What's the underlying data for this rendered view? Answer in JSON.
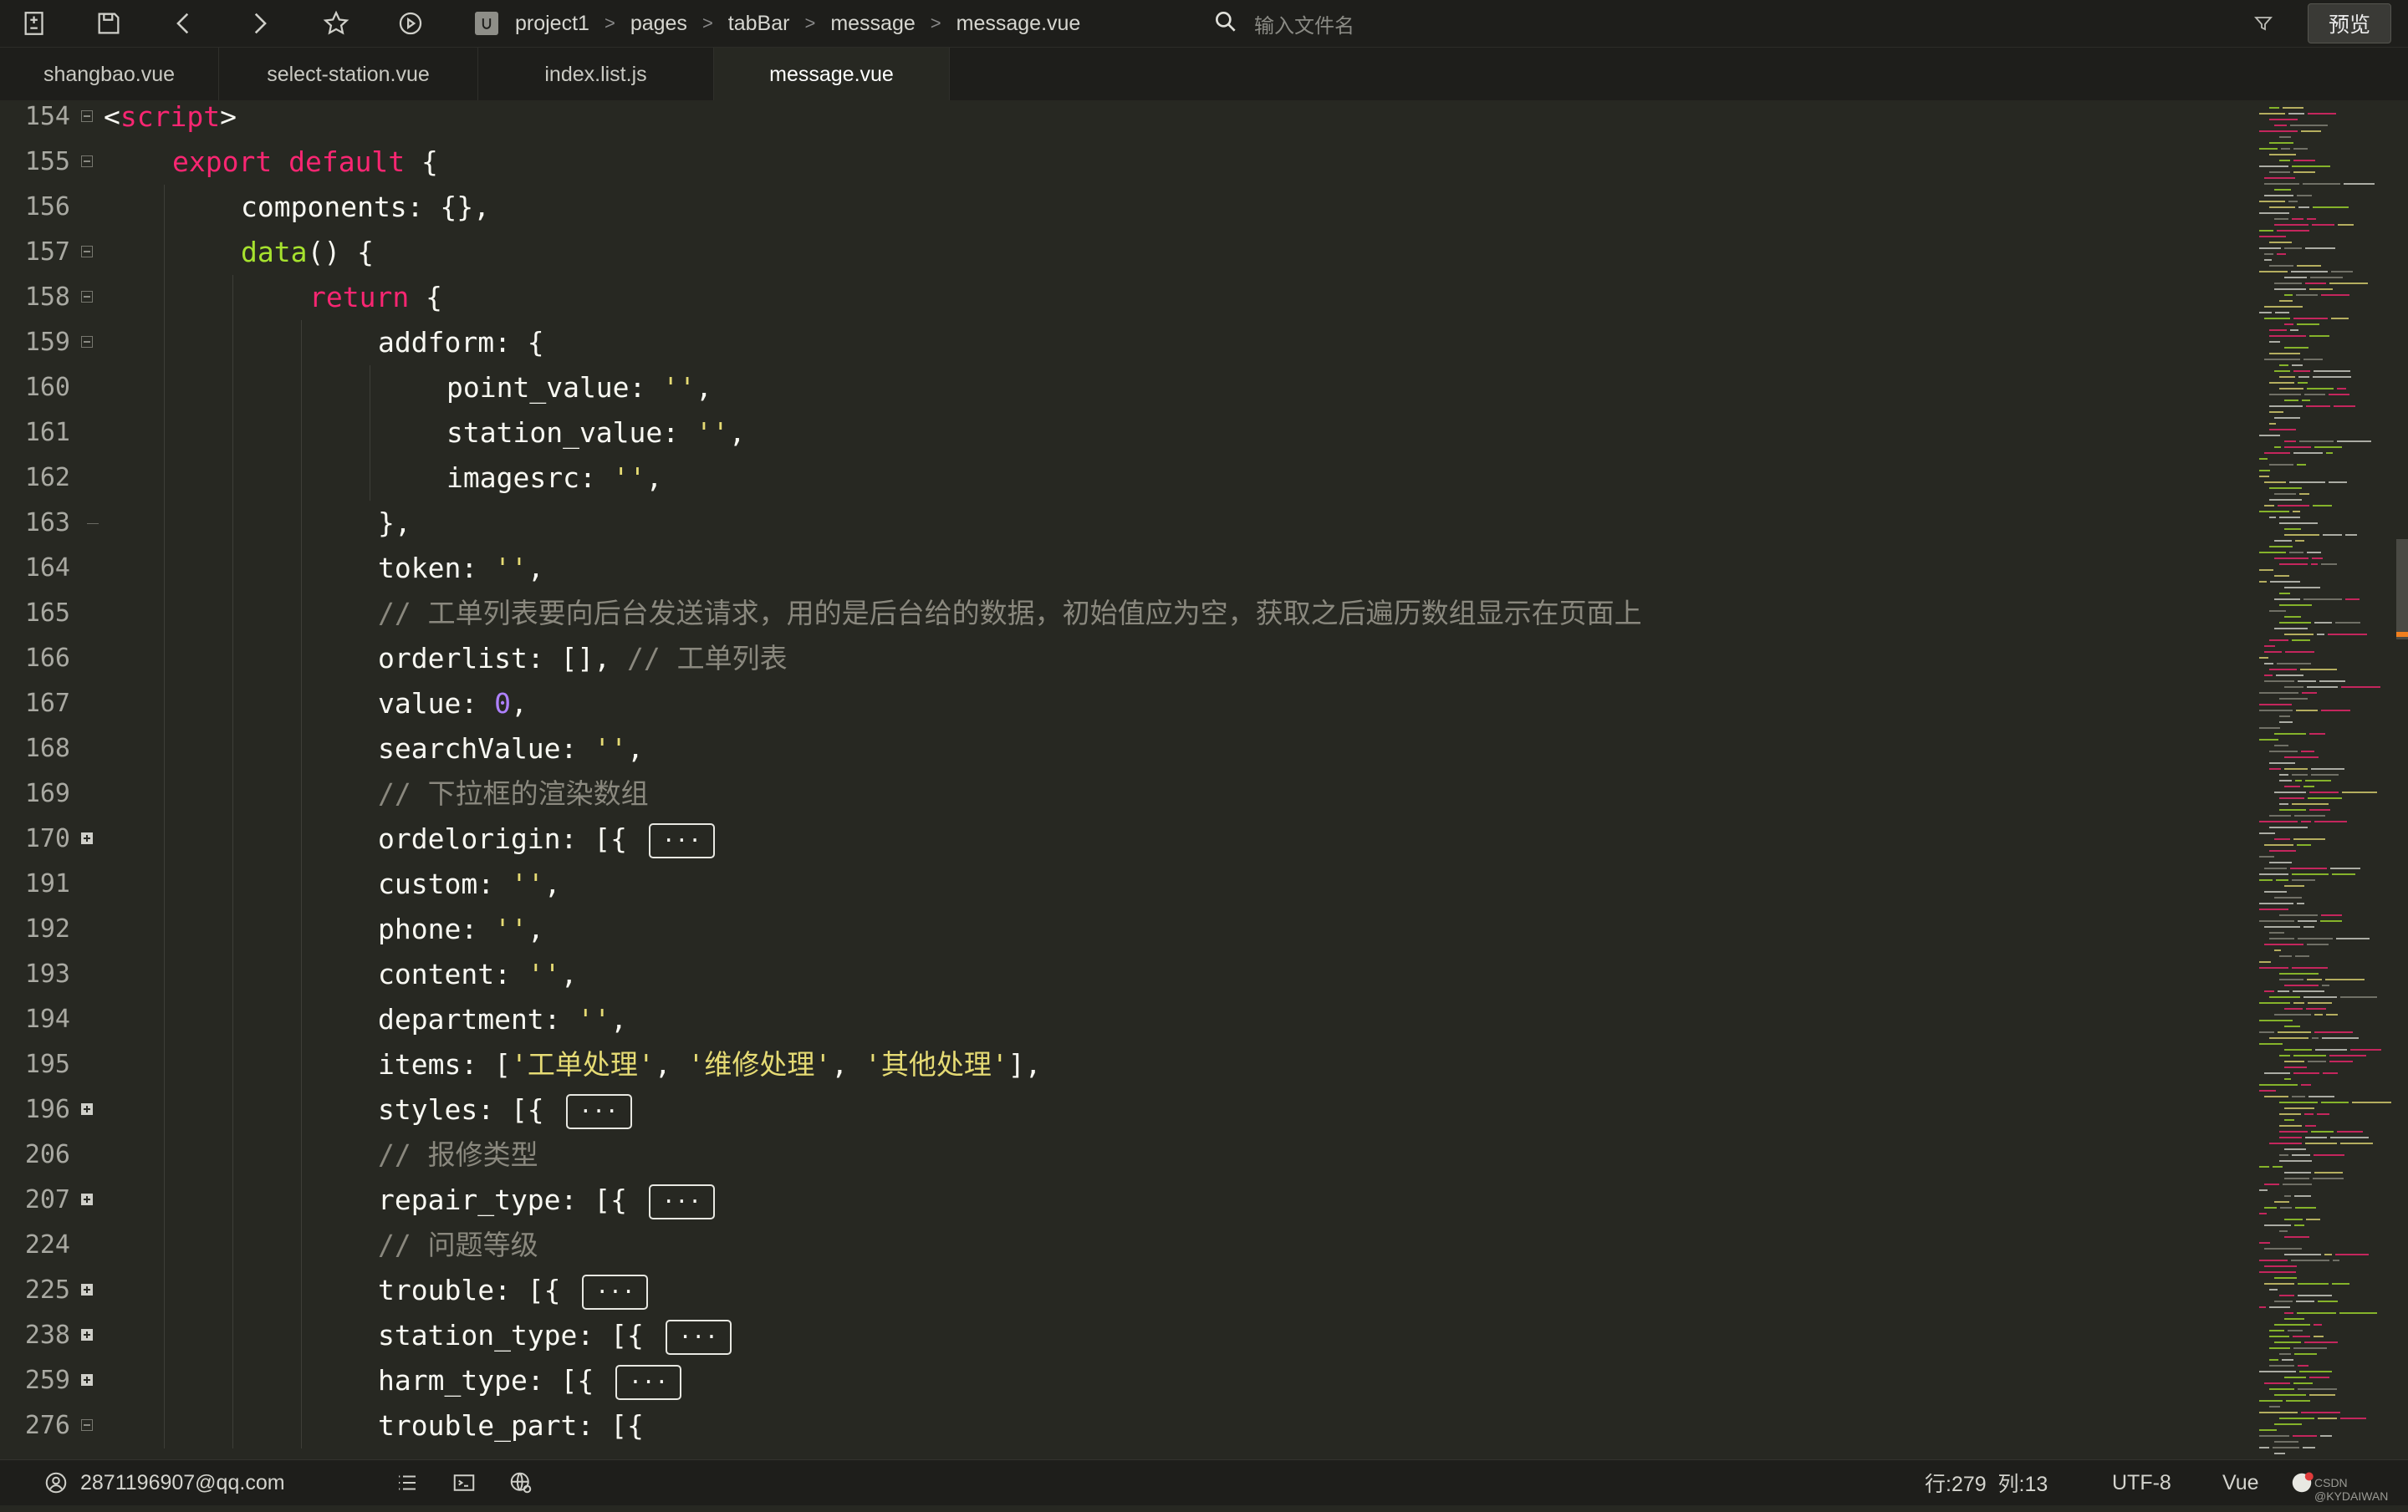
{
  "toolbar": {
    "breadcrumb": [
      "project1",
      "pages",
      "tabBar",
      "message",
      "message.vue"
    ],
    "search_placeholder": "输入文件名",
    "preview_label": "预览"
  },
  "tabs": [
    {
      "label": "shangbao.vue",
      "active": false
    },
    {
      "label": "select-station.vue",
      "active": false
    },
    {
      "label": "index.list.js",
      "active": false
    },
    {
      "label": "message.vue",
      "active": true
    }
  ],
  "code": {
    "lines": [
      {
        "n": "154",
        "fold": "minus",
        "indent": 0,
        "html": "&lt;<span class=\"kw\">script</span>&gt;"
      },
      {
        "n": "155",
        "fold": "minus",
        "indent": 1,
        "html": "<span class=\"kw\">export</span> <span class=\"kw\">default</span> {"
      },
      {
        "n": "156",
        "fold": "",
        "indent": 2,
        "html": "components: {},"
      },
      {
        "n": "157",
        "fold": "minus",
        "indent": 2,
        "html": "<span class=\"fn\">data</span>() {"
      },
      {
        "n": "158",
        "fold": "minus",
        "indent": 3,
        "html": "<span class=\"kw\">return</span> {"
      },
      {
        "n": "159",
        "fold": "minus",
        "indent": 4,
        "html": "addform: {"
      },
      {
        "n": "160",
        "fold": "",
        "indent": 5,
        "html": "point_value: <span class=\"str\">''</span>,"
      },
      {
        "n": "161",
        "fold": "",
        "indent": 5,
        "html": "station_value: <span class=\"str\">''</span>,"
      },
      {
        "n": "162",
        "fold": "",
        "indent": 5,
        "html": "imagesrc: <span class=\"str\">''</span>,"
      },
      {
        "n": "163",
        "fold": "end",
        "indent": 4,
        "html": "},"
      },
      {
        "n": "164",
        "fold": "",
        "indent": 4,
        "html": "token: <span class=\"str\">''</span>,"
      },
      {
        "n": "165",
        "fold": "",
        "indent": 4,
        "html": "<span class=\"cm\">// 工单列表要向后台发送请求，用的是后台给的数据，初始值应为空，获取之后遍历数组显示在页面上</span>"
      },
      {
        "n": "166",
        "fold": "",
        "indent": 4,
        "html": "orderlist: [], <span class=\"cm\">// 工单列表</span>"
      },
      {
        "n": "167",
        "fold": "",
        "indent": 4,
        "html": "value: <span class=\"num\">0</span>,"
      },
      {
        "n": "168",
        "fold": "",
        "indent": 4,
        "html": "searchValue: <span class=\"str\">''</span>,"
      },
      {
        "n": "169",
        "fold": "",
        "indent": 4,
        "html": "<span class=\"cm\">// 下拉框的渲染数组</span>"
      },
      {
        "n": "170",
        "fold": "plus",
        "indent": 4,
        "html": "ordelorigin: [{ <span class=\"collapsed\">···</span>"
      },
      {
        "n": "191",
        "fold": "",
        "indent": 4,
        "html": "custom: <span class=\"str\">''</span>,"
      },
      {
        "n": "192",
        "fold": "",
        "indent": 4,
        "html": "phone: <span class=\"str\">''</span>,"
      },
      {
        "n": "193",
        "fold": "",
        "indent": 4,
        "html": "content: <span class=\"str\">''</span>,"
      },
      {
        "n": "194",
        "fold": "",
        "indent": 4,
        "html": "department: <span class=\"str\">''</span>,"
      },
      {
        "n": "195",
        "fold": "",
        "indent": 4,
        "html": "items: [<span class=\"str\">'工单处理'</span>, <span class=\"str\">'维修处理'</span>, <span class=\"str\">'其他处理'</span>],"
      },
      {
        "n": "196",
        "fold": "plus",
        "indent": 4,
        "html": "styles: [{ <span class=\"collapsed\">···</span>"
      },
      {
        "n": "206",
        "fold": "",
        "indent": 4,
        "html": "<span class=\"cm\">// 报修类型</span>"
      },
      {
        "n": "207",
        "fold": "plus",
        "indent": 4,
        "html": "repair_type: [{ <span class=\"collapsed\">···</span>"
      },
      {
        "n": "224",
        "fold": "",
        "indent": 4,
        "html": "<span class=\"cm\">// 问题等级</span>"
      },
      {
        "n": "225",
        "fold": "plus",
        "indent": 4,
        "html": "trouble: [{ <span class=\"collapsed\">···</span>"
      },
      {
        "n": "238",
        "fold": "plus",
        "indent": 4,
        "html": "station_type: [{ <span class=\"collapsed\">···</span>"
      },
      {
        "n": "259",
        "fold": "plus",
        "indent": 4,
        "html": "harm_type: [{ <span class=\"collapsed\">···</span>"
      },
      {
        "n": "276",
        "fold": "minus",
        "indent": 4,
        "html": "trouble_part: [{"
      }
    ]
  },
  "status": {
    "user": "2871196907@qq.com",
    "position": "行:279  列:13",
    "encoding": "UTF-8",
    "language": "Vue",
    "watermark": "CSDN @KYDAIWAN"
  },
  "colors": {
    "background": "#272822",
    "keyword": "#f92672",
    "function": "#a6e22e",
    "string": "#e6db74",
    "number": "#ae81ff",
    "comment": "#8a887e"
  },
  "icons": [
    "new-file-icon",
    "save-icon",
    "back-icon",
    "forward-icon",
    "star-icon",
    "run-icon",
    "search-icon",
    "filter-icon",
    "user-icon",
    "list-icon",
    "terminal-icon",
    "globe-icon",
    "notification-icon"
  ]
}
